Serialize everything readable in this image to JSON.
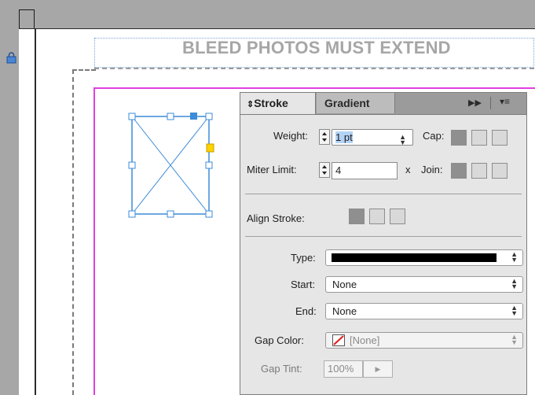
{
  "document": {
    "bleed_notice": "BLEED PHOTOS MUST EXTEND"
  },
  "stroke_panel": {
    "tabs": [
      {
        "label": "Stroke",
        "icon": "collapse-arrows-icon",
        "active": true
      },
      {
        "label": "Gradient",
        "active": false
      }
    ],
    "weight_label": "Weight:",
    "weight_value": "1 pt",
    "cap_label": "Cap:",
    "miter_label": "Miter Limit:",
    "miter_value": "4",
    "times_label": "x",
    "join_label": "Join:",
    "align_label": "Align Stroke:",
    "type_label": "Type:",
    "start_label": "Start:",
    "start_value": "None",
    "end_label": "End:",
    "end_value": "None",
    "gap_color_label": "Gap Color:",
    "gap_color_value": "[None]",
    "gap_tint_label": "Gap Tint:",
    "gap_tint_value": "100%"
  },
  "colors": {
    "trim_guide": "#e040e0",
    "frame_selection": "#3d8bd9",
    "panel_bg": "#e6e6e6"
  }
}
